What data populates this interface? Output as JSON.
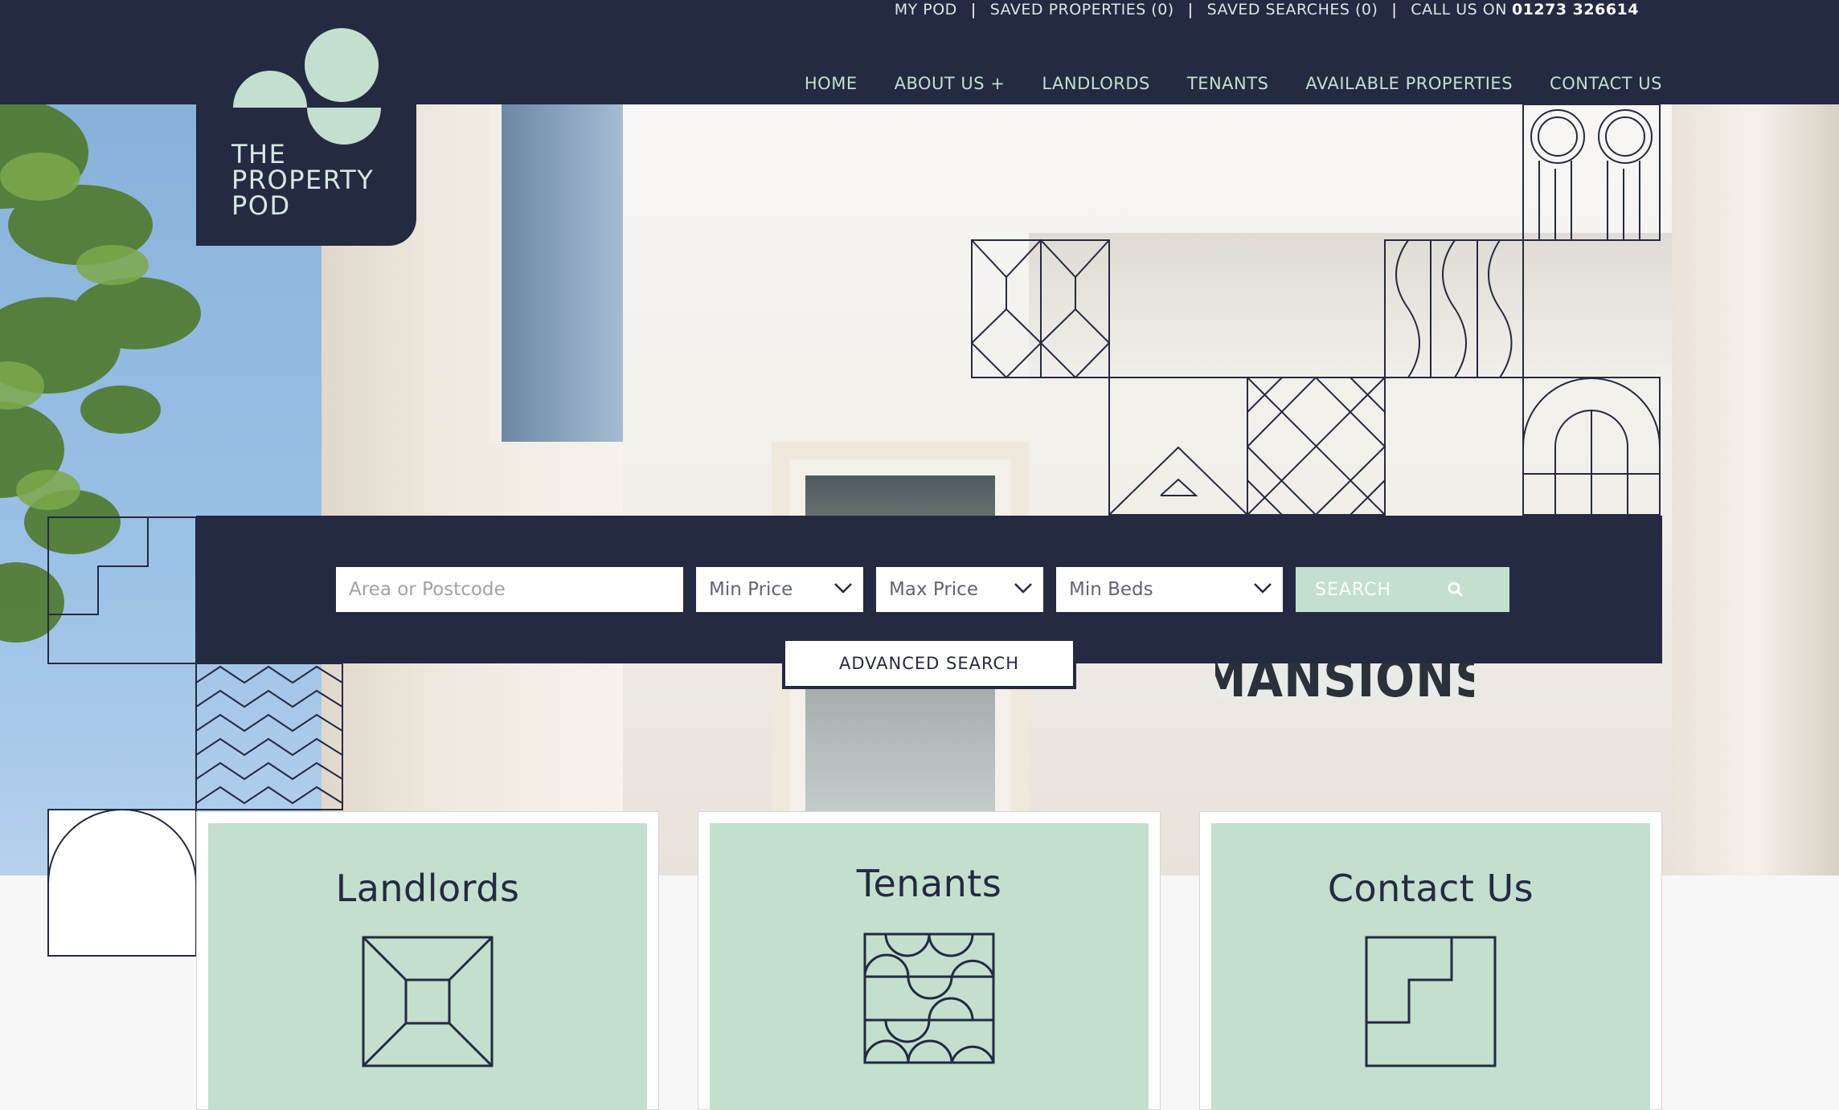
{
  "topbar": {
    "my_pod": "MY POD",
    "saved_properties": "SAVED PROPERTIES (0)",
    "saved_searches": "SAVED SEARCHES (0)",
    "call_label": "CALL US ON",
    "phone": "01273 326614",
    "separator": "|"
  },
  "nav": {
    "home": "HOME",
    "about": "ABOUT US +",
    "landlords": "LANDLORDS",
    "tenants": "TENANTS",
    "available": "AVAILABLE PROPERTIES",
    "contact": "CONTACT US"
  },
  "logo": {
    "line1": "THE",
    "line2": "PROPERTY",
    "line3": "POD"
  },
  "hero": {
    "sign_text": "MANSIONS"
  },
  "search": {
    "area_placeholder": "Area or Postcode",
    "min_price": "Min Price",
    "max_price": "Max Price",
    "min_beds": "Min Beds",
    "search_label": "SEARCH",
    "advanced_label": "ADVANCED SEARCH"
  },
  "cards": [
    {
      "title": "Landlords",
      "icon": "framed-square-icon"
    },
    {
      "title": "Tenants",
      "icon": "wave-pattern-icon"
    },
    {
      "title": "Contact Us",
      "icon": "step-corner-icon"
    }
  ],
  "colors": {
    "navy": "#232a41",
    "mint": "#c2e0cd",
    "mint_text": "#d7e9df"
  }
}
